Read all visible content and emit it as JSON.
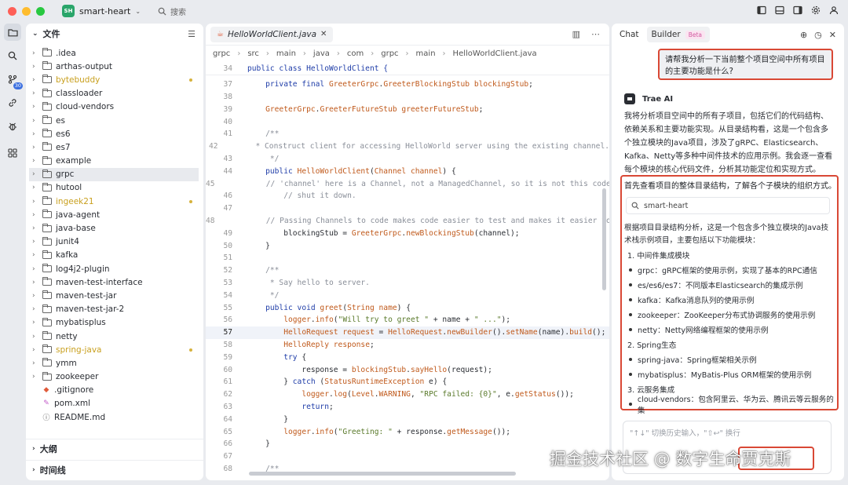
{
  "window": {
    "project_badge": "SH",
    "project_name": "smart-heart",
    "search_label": "搜索"
  },
  "activity": {
    "badge": "30"
  },
  "explorer": {
    "title": "文件",
    "items": [
      {
        "label": ".idea",
        "type": "folder",
        "modified": false
      },
      {
        "label": "arthas-output",
        "type": "folder",
        "modified": false
      },
      {
        "label": "bytebuddy",
        "type": "folder",
        "modified": true
      },
      {
        "label": "classloader",
        "type": "folder",
        "modified": false
      },
      {
        "label": "cloud-vendors",
        "type": "folder",
        "modified": false
      },
      {
        "label": "es",
        "type": "folder",
        "modified": false
      },
      {
        "label": "es6",
        "type": "folder",
        "modified": false
      },
      {
        "label": "es7",
        "type": "folder",
        "modified": false
      },
      {
        "label": "example",
        "type": "folder",
        "modified": false
      },
      {
        "label": "grpc",
        "type": "folder",
        "modified": false,
        "selected": true
      },
      {
        "label": "hutool",
        "type": "folder",
        "modified": false
      },
      {
        "label": "ingeek21",
        "type": "folder",
        "modified": true
      },
      {
        "label": "java-agent",
        "type": "folder",
        "modified": false
      },
      {
        "label": "java-base",
        "type": "folder",
        "modified": false
      },
      {
        "label": "junit4",
        "type": "folder",
        "modified": false
      },
      {
        "label": "kafka",
        "type": "folder",
        "modified": false
      },
      {
        "label": "log4j2-plugin",
        "type": "folder",
        "modified": false
      },
      {
        "label": "maven-test-interface",
        "type": "folder",
        "modified": false
      },
      {
        "label": "maven-test-jar",
        "type": "folder",
        "modified": false
      },
      {
        "label": "maven-test-jar-2",
        "type": "folder",
        "modified": false
      },
      {
        "label": "mybatisplus",
        "type": "folder",
        "modified": false
      },
      {
        "label": "netty",
        "type": "folder",
        "modified": false
      },
      {
        "label": "spring-java",
        "type": "folder",
        "modified": true
      },
      {
        "label": "ymm",
        "type": "folder",
        "modified": false
      },
      {
        "label": "zookeeper",
        "type": "folder",
        "modified": false
      },
      {
        "label": ".gitignore",
        "type": "git",
        "modified": false
      },
      {
        "label": "pom.xml",
        "type": "xml",
        "modified": false
      },
      {
        "label": "README.md",
        "type": "md",
        "modified": false
      }
    ],
    "outline_label": "大纲",
    "timeline_label": "时间线"
  },
  "editor": {
    "tab_label": "HelloWorldClient.java",
    "breadcrumbs": [
      "grpc",
      "src",
      "main",
      "java",
      "com",
      "grpc",
      "main",
      "HelloWorldClient.java"
    ],
    "sticky_header": "public class HelloWorldClient {",
    "sticky_line": "34",
    "current_line": "57",
    "lines": [
      {
        "n": "37",
        "tokens": [
          [
            "    ",
            ""
          ],
          [
            "private final ",
            "kw"
          ],
          [
            "GreeterGrpc",
            "ty"
          ],
          [
            ".",
            "id"
          ],
          [
            "GreeterBlockingStub",
            "ty"
          ],
          [
            " ",
            ""
          ],
          [
            "blockingStub",
            "fld"
          ],
          [
            ";",
            "id"
          ]
        ]
      },
      {
        "n": "38",
        "tokens": []
      },
      {
        "n": "39",
        "tokens": [
          [
            "    ",
            ""
          ],
          [
            "GreeterGrpc",
            "ty"
          ],
          [
            ".",
            "id"
          ],
          [
            "GreeterFutureStub",
            "ty"
          ],
          [
            " ",
            ""
          ],
          [
            "greeterFutureStub",
            "fld"
          ],
          [
            ";",
            "id"
          ]
        ]
      },
      {
        "n": "40",
        "tokens": []
      },
      {
        "n": "41",
        "tokens": [
          [
            "    /**",
            "cm"
          ]
        ]
      },
      {
        "n": "42",
        "tokens": [
          [
            "     * Construct client for accessing HelloWorld server using the existing channel.",
            "cm"
          ]
        ]
      },
      {
        "n": "43",
        "tokens": [
          [
            "     */",
            "cm"
          ]
        ]
      },
      {
        "n": "44",
        "tokens": [
          [
            "    ",
            ""
          ],
          [
            "public ",
            "kw"
          ],
          [
            "HelloWorldClient",
            "fn"
          ],
          [
            "(",
            "id"
          ],
          [
            "Channel",
            "ty"
          ],
          [
            " ",
            ""
          ],
          [
            "channel",
            "fld"
          ],
          [
            ") {",
            "id"
          ]
        ]
      },
      {
        "n": "45",
        "tokens": [
          [
            "        // 'channel' here is a Channel, not a ManagedChannel, so it is not this code's",
            "cm"
          ]
        ]
      },
      {
        "n": "46",
        "tokens": [
          [
            "        // shut it down.",
            "cm"
          ]
        ]
      },
      {
        "n": "47",
        "tokens": []
      },
      {
        "n": "48",
        "tokens": [
          [
            "        // Passing Channels to code makes code easier to test and makes it easier to",
            "cm"
          ]
        ]
      },
      {
        "n": "49",
        "tokens": [
          [
            "        blockingStub = ",
            "id"
          ],
          [
            "GreeterGrpc",
            "ty"
          ],
          [
            ".",
            "id"
          ],
          [
            "newBlockingStub",
            "fn"
          ],
          [
            "(channel);",
            "id"
          ]
        ]
      },
      {
        "n": "50",
        "tokens": [
          [
            "    }",
            "id"
          ]
        ]
      },
      {
        "n": "51",
        "tokens": []
      },
      {
        "n": "52",
        "tokens": [
          [
            "    /**",
            "cm"
          ]
        ]
      },
      {
        "n": "53",
        "tokens": [
          [
            "     * Say hello to server.",
            "cm"
          ]
        ]
      },
      {
        "n": "54",
        "tokens": [
          [
            "     */",
            "cm"
          ]
        ]
      },
      {
        "n": "55",
        "tokens": [
          [
            "    ",
            ""
          ],
          [
            "public void ",
            "kw"
          ],
          [
            "greet",
            "fn"
          ],
          [
            "(",
            "id"
          ],
          [
            "String",
            "ty"
          ],
          [
            " ",
            ""
          ],
          [
            "name",
            "fld"
          ],
          [
            ") {",
            "id"
          ]
        ]
      },
      {
        "n": "56",
        "tokens": [
          [
            "        ",
            ""
          ],
          [
            "logger",
            "fld"
          ],
          [
            ".",
            "id"
          ],
          [
            "info",
            "fn"
          ],
          [
            "(",
            "id"
          ],
          [
            "\"Will try to greet \"",
            "str"
          ],
          [
            " + name + ",
            "id"
          ],
          [
            "\" ...\"",
            "str"
          ],
          [
            ");",
            "id"
          ]
        ]
      },
      {
        "n": "57",
        "tokens": [
          [
            "        ",
            ""
          ],
          [
            "HelloRequest",
            "ty"
          ],
          [
            " ",
            ""
          ],
          [
            "request",
            "fld"
          ],
          [
            " = ",
            "id"
          ],
          [
            "HelloRequest",
            "ty"
          ],
          [
            ".",
            "id"
          ],
          [
            "newBuilder",
            "fn"
          ],
          [
            "().",
            "id"
          ],
          [
            "setName",
            "fn"
          ],
          [
            "(name).",
            "id"
          ],
          [
            "build",
            "fn"
          ],
          [
            "();",
            "id"
          ]
        ]
      },
      {
        "n": "58",
        "tokens": [
          [
            "        ",
            ""
          ],
          [
            "HelloReply",
            "ty"
          ],
          [
            " ",
            ""
          ],
          [
            "response",
            "fld"
          ],
          [
            ";",
            "id"
          ]
        ]
      },
      {
        "n": "59",
        "tokens": [
          [
            "        ",
            ""
          ],
          [
            "try ",
            "kw"
          ],
          [
            "{",
            "id"
          ]
        ]
      },
      {
        "n": "60",
        "tokens": [
          [
            "            response = ",
            "id"
          ],
          [
            "blockingStub",
            "fld"
          ],
          [
            ".",
            "id"
          ],
          [
            "sayHello",
            "fn"
          ],
          [
            "(request);",
            "id"
          ]
        ]
      },
      {
        "n": "61",
        "tokens": [
          [
            "        } ",
            "id"
          ],
          [
            "catch ",
            "kw"
          ],
          [
            "(",
            "id"
          ],
          [
            "StatusRuntimeException",
            "ty"
          ],
          [
            " e) {",
            "id"
          ]
        ]
      },
      {
        "n": "62",
        "tokens": [
          [
            "            ",
            ""
          ],
          [
            "logger",
            "fld"
          ],
          [
            ".",
            "id"
          ],
          [
            "log",
            "fn"
          ],
          [
            "(",
            "id"
          ],
          [
            "Level",
            "ty"
          ],
          [
            ".",
            "id"
          ],
          [
            "WARNING",
            "fld"
          ],
          [
            ", ",
            "id"
          ],
          [
            "\"RPC failed: {0}\"",
            "str"
          ],
          [
            ", e.",
            "id"
          ],
          [
            "getStatus",
            "fn"
          ],
          [
            "());",
            "id"
          ]
        ]
      },
      {
        "n": "63",
        "tokens": [
          [
            "            ",
            ""
          ],
          [
            "return",
            "kw"
          ],
          [
            ";",
            "id"
          ]
        ]
      },
      {
        "n": "64",
        "tokens": [
          [
            "        }",
            "id"
          ]
        ]
      },
      {
        "n": "65",
        "tokens": [
          [
            "        ",
            ""
          ],
          [
            "logger",
            "fld"
          ],
          [
            ".",
            "id"
          ],
          [
            "info",
            "fn"
          ],
          [
            "(",
            "id"
          ],
          [
            "\"Greeting: \"",
            "str"
          ],
          [
            " + response.",
            "id"
          ],
          [
            "getMessage",
            "fn"
          ],
          [
            "());",
            "id"
          ]
        ]
      },
      {
        "n": "66",
        "tokens": [
          [
            "    }",
            "id"
          ]
        ]
      },
      {
        "n": "67",
        "tokens": []
      },
      {
        "n": "68",
        "tokens": [
          [
            "    /**",
            "cm"
          ]
        ]
      }
    ]
  },
  "chat": {
    "tab_chat": "Chat",
    "tab_builder": "Builder",
    "beta_badge": "Beta",
    "user_message": "请帮我分析一下当前整个项目空间中所有项目的主要功能是什么?",
    "ai_name": "Trae AI",
    "ai_intro": "我将分析项目空间中的所有子项目，包括它们的代码结构、依赖关系和主要功能实现。从目录结构看，这是一个包含多个独立模块的Java项目，涉及了gRPC、Elasticsearch、Kafka、Netty等多种中间件技术的应用示例。我会逐一查看每个模块的核心代码文件，分析其功能定位和实现方式。",
    "step_text": "首先查看项目的整体目录结构，了解各个子模块的组织方式。",
    "tool_label": "smart-heart",
    "result_intro": "根据项目目录结构分析，这是一个包含多个独立模块的Java技术栈示例项目，主要包括以下功能模块：",
    "list": [
      {
        "kind": "num",
        "text": "1. 中间件集成模块"
      },
      {
        "kind": "bul",
        "text": "grpc：gRPC框架的使用示例，实现了基本的RPC通信"
      },
      {
        "kind": "bul",
        "text": "es/es6/es7：不同版本Elasticsearch的集成示例"
      },
      {
        "kind": "bul",
        "text": "kafka：Kafka消息队列的使用示例"
      },
      {
        "kind": "bul",
        "text": "zookeeper：ZooKeeper分布式协调服务的使用示例"
      },
      {
        "kind": "bul",
        "text": "netty：Netty网络编程框架的使用示例"
      },
      {
        "kind": "num",
        "text": "2. Spring生态"
      },
      {
        "kind": "bul",
        "text": "spring-java：Spring框架相关示例"
      },
      {
        "kind": "bul",
        "text": "mybatisplus：MyBatis-Plus ORM框架的使用示例"
      },
      {
        "kind": "num",
        "text": "3. 云服务集成"
      },
      {
        "kind": "bul",
        "text": "cloud-vendors：包含阿里云、华为云、腾讯云等云服务的集"
      }
    ],
    "input_placeholder": "\"↑↓\" 切换历史输入，\"⇧↩\" 换行"
  },
  "watermark": "掘金技术社区 @ 数字生命贾克斯",
  "colors": {
    "accent": "#d94835",
    "modified": "#c9a01f",
    "badge_green": "#2aa56a",
    "badge_blue": "#3b6fe0"
  }
}
